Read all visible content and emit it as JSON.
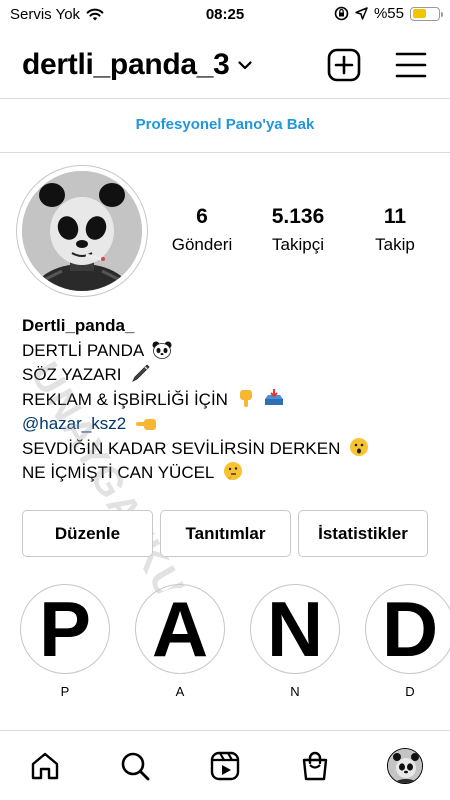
{
  "status_bar": {
    "carrier": "Servis Yok",
    "time": "08:25",
    "battery_percent": "%55",
    "battery_level": 0.55,
    "icons": [
      "wifi-icon",
      "orientation-lock-icon",
      "location-arrow-icon",
      "battery-icon"
    ]
  },
  "header": {
    "username": "dertli_panda_3",
    "icons": [
      "chevron-down-icon",
      "add-post-icon",
      "menu-icon"
    ]
  },
  "pro_dashboard": {
    "label": "Profesyonel Pano'ya Bak",
    "color": "#2296dc"
  },
  "stats": [
    {
      "value": "6",
      "label": "Gönderi"
    },
    {
      "value": "5.136",
      "label": "Takipçi"
    },
    {
      "value": "11",
      "label": "Takip"
    }
  ],
  "bio": {
    "name": "Dertli_panda_",
    "lines": [
      "DERTLİ PANDA",
      "SÖZ YAZARI",
      "REKLAM & İŞBİRLİĞİ İÇİN",
      "@hazar_ksz2",
      "SEVDİĞİN KADAR SEVİLİRSİN DERKEN",
      "NE İÇMİŞTİ CAN YÜCEL"
    ],
    "link_color": "#00376b"
  },
  "watermark": "UNAYGATKULT",
  "buttons": {
    "edit": "Düzenle",
    "promotions": "Tanıtımlar",
    "insights": "İstatistikler"
  },
  "highlights": [
    {
      "letter": "P",
      "label": "P"
    },
    {
      "letter": "A",
      "label": "A"
    },
    {
      "letter": "N",
      "label": "N"
    },
    {
      "letter": "D",
      "label": "D"
    }
  ],
  "bottom_nav": [
    "home-icon",
    "search-icon",
    "reels-icon",
    "shop-icon",
    "profile-avatar"
  ]
}
